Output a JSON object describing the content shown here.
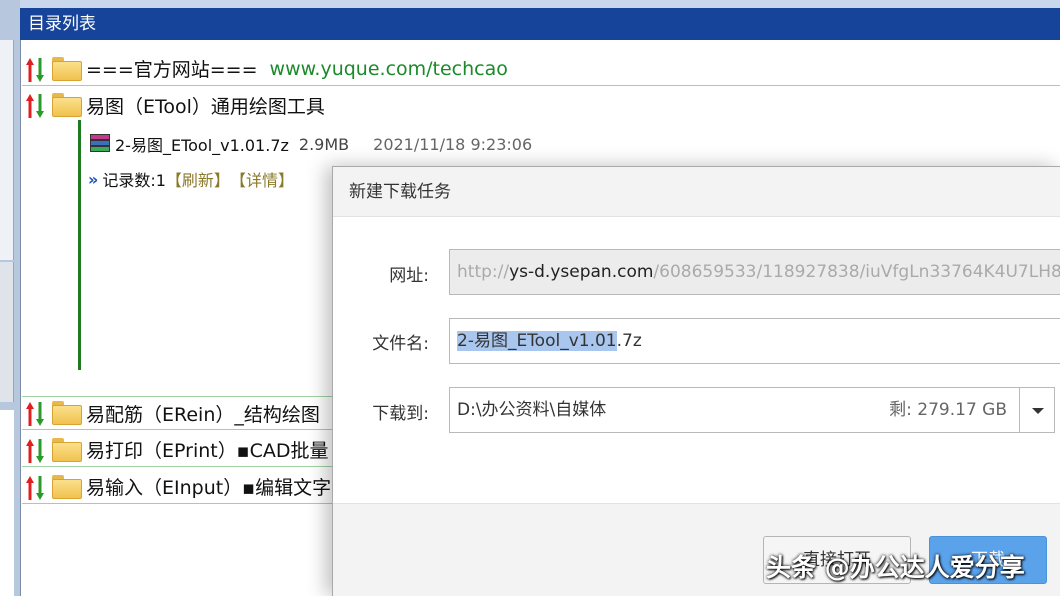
{
  "window": {
    "title": "目录列表"
  },
  "tree": {
    "root_items": [
      {
        "label": "===官方网站===",
        "site": "www.yuque.com/techcao"
      },
      {
        "label": "易图（ETool）通用绘图工具"
      },
      {
        "label": "易配筋（ERein）_结构绘图"
      },
      {
        "label": "易打印（EPrint）▪CAD批量"
      },
      {
        "label": "易输入（EInput）▪编辑文字"
      }
    ],
    "file": {
      "name": "2-易图_ETool_v1.01.7z",
      "size": "2.9MB",
      "date": "2021/11/18 9:23:06"
    },
    "record": {
      "count_label": "记录数:1",
      "refresh": "【刷新】",
      "detail": "【详情】"
    }
  },
  "dialog": {
    "title": "新建下载任务",
    "url_label": "网址:",
    "url": {
      "scheme": "http://",
      "domain": "ys-d.ysepan.com",
      "path": "/608659533/118927838/iuVfgLn33764K4U7LH8"
    },
    "filename_label": "文件名:",
    "filename": {
      "selected": "2-易图_ETool_v1.01",
      "rest": ".7z"
    },
    "dest_label": "下载到:",
    "dest": "D:\\办公资料\\自媒体",
    "free_space": "剩: 279.17 GB",
    "btn_open": "直接打开",
    "btn_download": "下载"
  },
  "watermark": "头条 @办公达人爱分享",
  "colors": {
    "title_bar": "#16449a",
    "link_green": "#1a8a2a",
    "primary_button": "#5aa2ea",
    "selection": "#a9c7ee"
  }
}
